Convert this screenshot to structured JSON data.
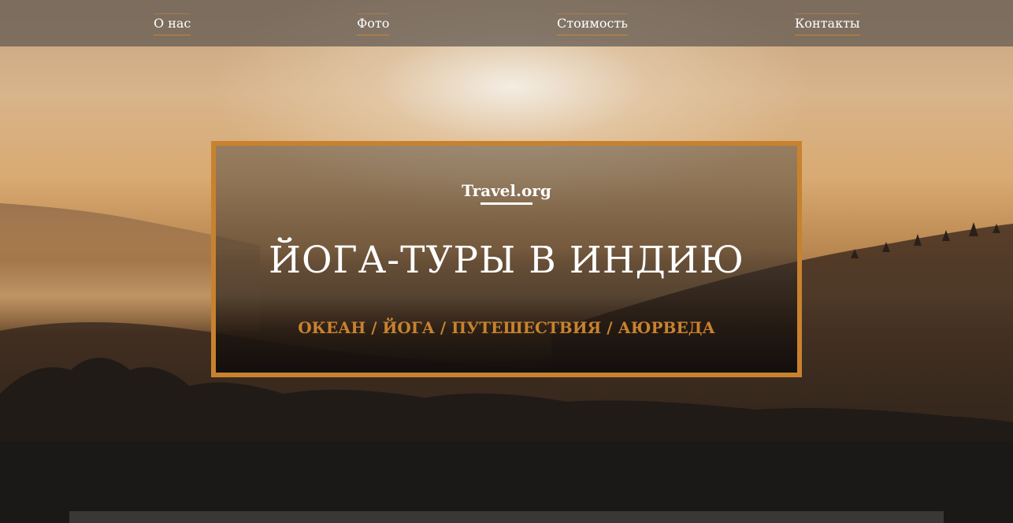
{
  "nav": {
    "items": [
      {
        "label": "О нас"
      },
      {
        "label": "Фото"
      },
      {
        "label": "Стоимость"
      },
      {
        "label": "Контакты"
      }
    ]
  },
  "hero": {
    "brand": "Travel.org",
    "headline": "ЙОГА-ТУРЫ В ИНДИЮ",
    "tags": "ОКЕАН / ЙОГА / ПУТЕШЕСТВИЯ / АЮРВЕДА"
  },
  "colors": {
    "accent": "#c8822f",
    "nav_background": "#5f5850",
    "text": "#ffffff"
  }
}
